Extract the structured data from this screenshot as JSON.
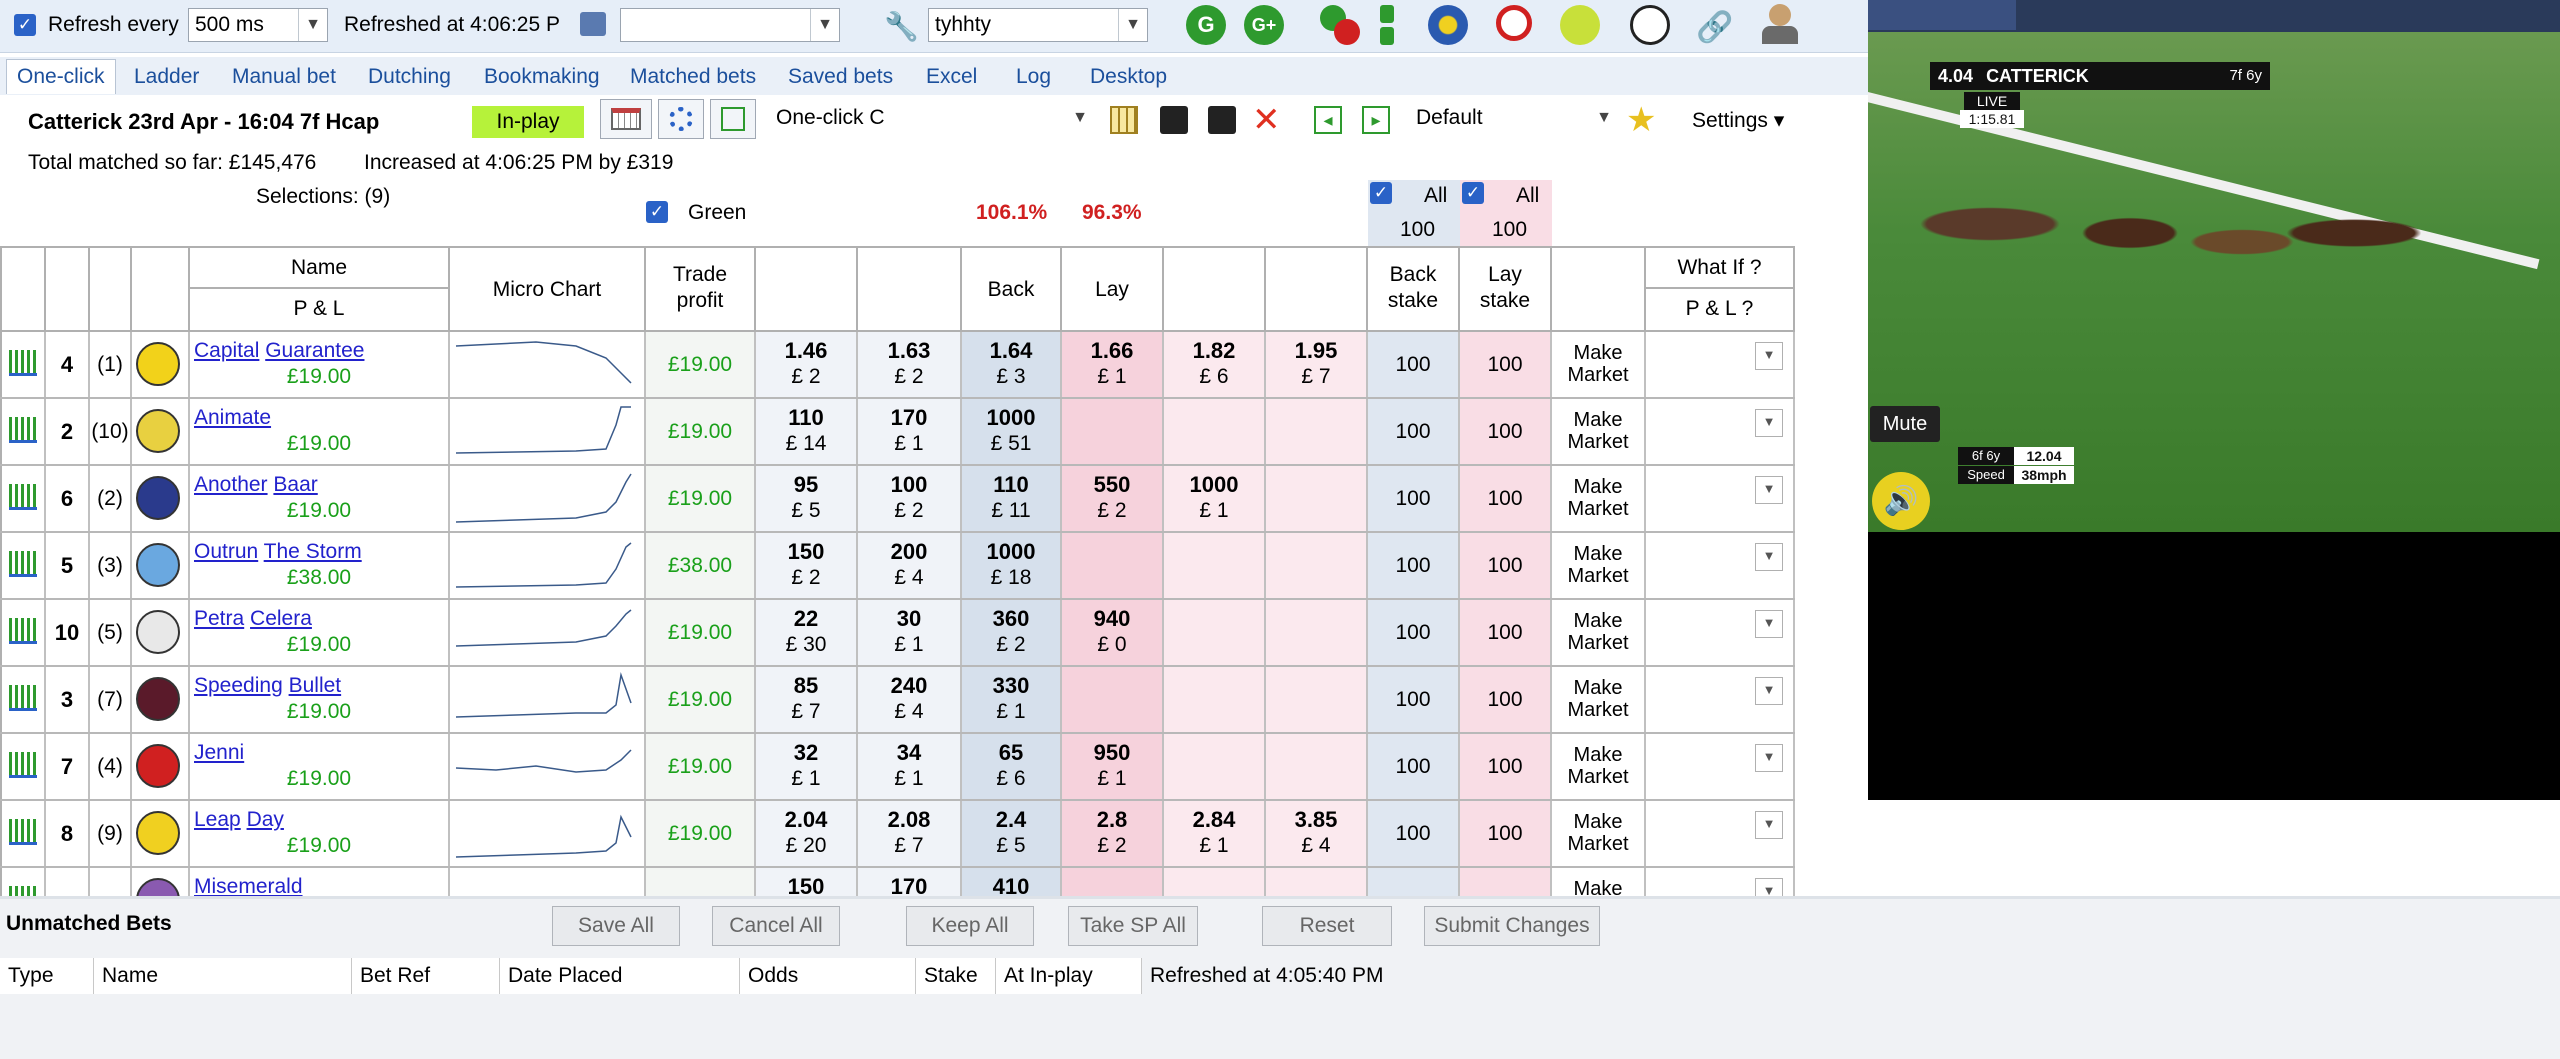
{
  "toolbar": {
    "refresh_label": "Refresh every",
    "refresh_value": "500 ms",
    "refreshed_at": "Refreshed  at 4:06:25 P",
    "profile_value": "tyhhty",
    "icon_g": "G",
    "icon_gplus": "G+"
  },
  "tabs": [
    "One-click",
    "Ladder",
    "Manual bet",
    "Dutching",
    "Bookmaking",
    "Matched bets",
    "Saved bets",
    "Excel",
    "Log",
    "Desktop"
  ],
  "market": {
    "title": "Catterick 23rd Apr - 16:04 7f Hcap",
    "status": "In-play",
    "view": "One-click C",
    "stake_profile": "Default",
    "settings": "Settings",
    "total_matched": "Total matched so far: £145,476",
    "increased": "Increased at 4:06:25 PM by £319",
    "selections": "Selections: (9)",
    "green_label": "Green",
    "back_book": "106.1%",
    "lay_book": "96.3%",
    "all_back_label": "All",
    "all_back_value": "100",
    "all_lay_label": "All",
    "all_lay_value": "100"
  },
  "headers": {
    "name": "Name",
    "pl": "P & L",
    "micro": "Micro Chart",
    "trade_1": "Trade",
    "trade_2": "profit",
    "back": "Back",
    "lay": "Lay",
    "back_stake_1": "Back",
    "back_stake_2": "stake",
    "lay_stake_1": "Lay",
    "lay_stake_2": "stake",
    "whatif": "What If ?",
    "whatif_pl": "P & L ?"
  },
  "runners": [
    {
      "num": "4",
      "draw": "(1)",
      "name1": "Capital",
      "name2": "Guarantee",
      "pl": "£19.00",
      "tp": "£19.00",
      "silk": "#f2d21a",
      "odds": [
        [
          "1.46",
          "£ 2"
        ],
        [
          "1.63",
          "£ 2"
        ],
        [
          "1.64",
          "£ 3"
        ],
        [
          "1.66",
          "£ 1"
        ],
        [
          "1.82",
          "£ 6"
        ],
        [
          "1.95",
          "£ 7"
        ]
      ],
      "bs": "100",
      "ls": "100",
      "mm1": "Make",
      "mm2": "Market"
    },
    {
      "num": "2",
      "draw": "(10)",
      "name1": "Animate",
      "name2": "",
      "pl": "£19.00",
      "tp": "£19.00",
      "silk": "#e8d040",
      "odds": [
        [
          "110",
          "£ 14"
        ],
        [
          "170",
          "£ 1"
        ],
        [
          "1000",
          "£ 51"
        ],
        [
          "",
          ""
        ],
        [
          "",
          ""
        ],
        [
          "",
          ""
        ]
      ],
      "bs": "100",
      "ls": "100",
      "mm1": "Make",
      "mm2": "Market"
    },
    {
      "num": "6",
      "draw": "(2)",
      "name1": "Another",
      "name2": "Baar",
      "pl": "£19.00",
      "tp": "£19.00",
      "silk": "#2a3a8c",
      "odds": [
        [
          "95",
          "£ 5"
        ],
        [
          "100",
          "£ 2"
        ],
        [
          "110",
          "£ 11"
        ],
        [
          "550",
          "£ 2"
        ],
        [
          "1000",
          "£ 1"
        ],
        [
          "",
          ""
        ]
      ],
      "bs": "100",
      "ls": "100",
      "mm1": "Make",
      "mm2": "Market"
    },
    {
      "num": "5",
      "draw": "(3)",
      "name1": "Outrun",
      "name2": "The Storm",
      "pl": "£38.00",
      "tp": "£38.00",
      "silk": "#6aa8e0",
      "odds": [
        [
          "150",
          "£ 2"
        ],
        [
          "200",
          "£ 4"
        ],
        [
          "1000",
          "£ 18"
        ],
        [
          "",
          ""
        ],
        [
          "",
          ""
        ],
        [
          "",
          ""
        ]
      ],
      "bs": "100",
      "ls": "100",
      "mm1": "Make",
      "mm2": "Market"
    },
    {
      "num": "10",
      "draw": "(5)",
      "name1": "Petra",
      "name2": "Celera",
      "pl": "£19.00",
      "tp": "£19.00",
      "silk": "#e8e8e8",
      "odds": [
        [
          "22",
          "£ 30"
        ],
        [
          "30",
          "£ 1"
        ],
        [
          "360",
          "£ 2"
        ],
        [
          "940",
          "£ 0"
        ],
        [
          "",
          ""
        ],
        [
          "",
          ""
        ]
      ],
      "bs": "100",
      "ls": "100",
      "mm1": "Make",
      "mm2": "Market"
    },
    {
      "num": "3",
      "draw": "(7)",
      "name1": "Speeding",
      "name2": "Bullet",
      "pl": "£19.00",
      "tp": "£19.00",
      "silk": "#5a1a2a",
      "odds": [
        [
          "85",
          "£ 7"
        ],
        [
          "240",
          "£ 4"
        ],
        [
          "330",
          "£ 1"
        ],
        [
          "",
          ""
        ],
        [
          "",
          ""
        ],
        [
          "",
          ""
        ]
      ],
      "bs": "100",
      "ls": "100",
      "mm1": "Make",
      "mm2": "Market"
    },
    {
      "num": "7",
      "draw": "(4)",
      "name1": "Jenni",
      "name2": "",
      "pl": "£19.00",
      "tp": "£19.00",
      "silk": "#d02020",
      "odds": [
        [
          "32",
          "£ 1"
        ],
        [
          "34",
          "£ 1"
        ],
        [
          "65",
          "£ 6"
        ],
        [
          "950",
          "£ 1"
        ],
        [
          "",
          ""
        ],
        [
          "",
          ""
        ]
      ],
      "bs": "100",
      "ls": "100",
      "mm1": "Make",
      "mm2": "Market"
    },
    {
      "num": "8",
      "draw": "(9)",
      "name1": "Leap",
      "name2": "Day",
      "pl": "£19.00",
      "tp": "£19.00",
      "silk": "#f0d020",
      "odds": [
        [
          "2.04",
          "£ 20"
        ],
        [
          "2.08",
          "£ 7"
        ],
        [
          "2.4",
          "£ 5"
        ],
        [
          "2.8",
          "£ 2"
        ],
        [
          "2.84",
          "£ 1"
        ],
        [
          "3.85",
          "£ 4"
        ]
      ],
      "bs": "100",
      "ls": "100",
      "mm1": "Make",
      "mm2": "Market"
    },
    {
      "num": "",
      "draw": "",
      "name1": "Misemerald",
      "name2": "",
      "pl": "",
      "tp": "",
      "silk": "#8a5ab0",
      "odds": [
        [
          "150",
          ""
        ],
        [
          "170",
          ""
        ],
        [
          "410",
          ""
        ],
        [
          "",
          ""
        ],
        [
          "",
          ""
        ],
        [
          "",
          ""
        ]
      ],
      "bs": "",
      "ls": "",
      "mm1": "Make",
      "mm2": ""
    }
  ],
  "unmatched": {
    "title": "Unmatched Bets",
    "buttons": [
      "Save All",
      "Cancel All",
      "Keep All",
      "Take SP All",
      "Reset",
      "Submit Changes"
    ],
    "columns": [
      "Type",
      "Name",
      "Bet Ref",
      "Date Placed",
      "Odds",
      "Stake",
      "At In-play",
      "Refreshed at 4:05:40 PM"
    ]
  },
  "video": {
    "odds": "4.04",
    "course": "CATTERICK",
    "distance_badge": "7f 6y",
    "live": "LIVE",
    "time": "1:15.81",
    "mute": "Mute",
    "stat1": "6f 6y",
    "stat1_val": "12.04",
    "stat2": "Speed",
    "stat2_val": "38mph"
  },
  "colors": {
    "accent": "#2a62c7",
    "back": "#dfe7f1",
    "lay": "#f9dde5",
    "profit": "#1aa01a",
    "inplay": "#b6f23a"
  }
}
